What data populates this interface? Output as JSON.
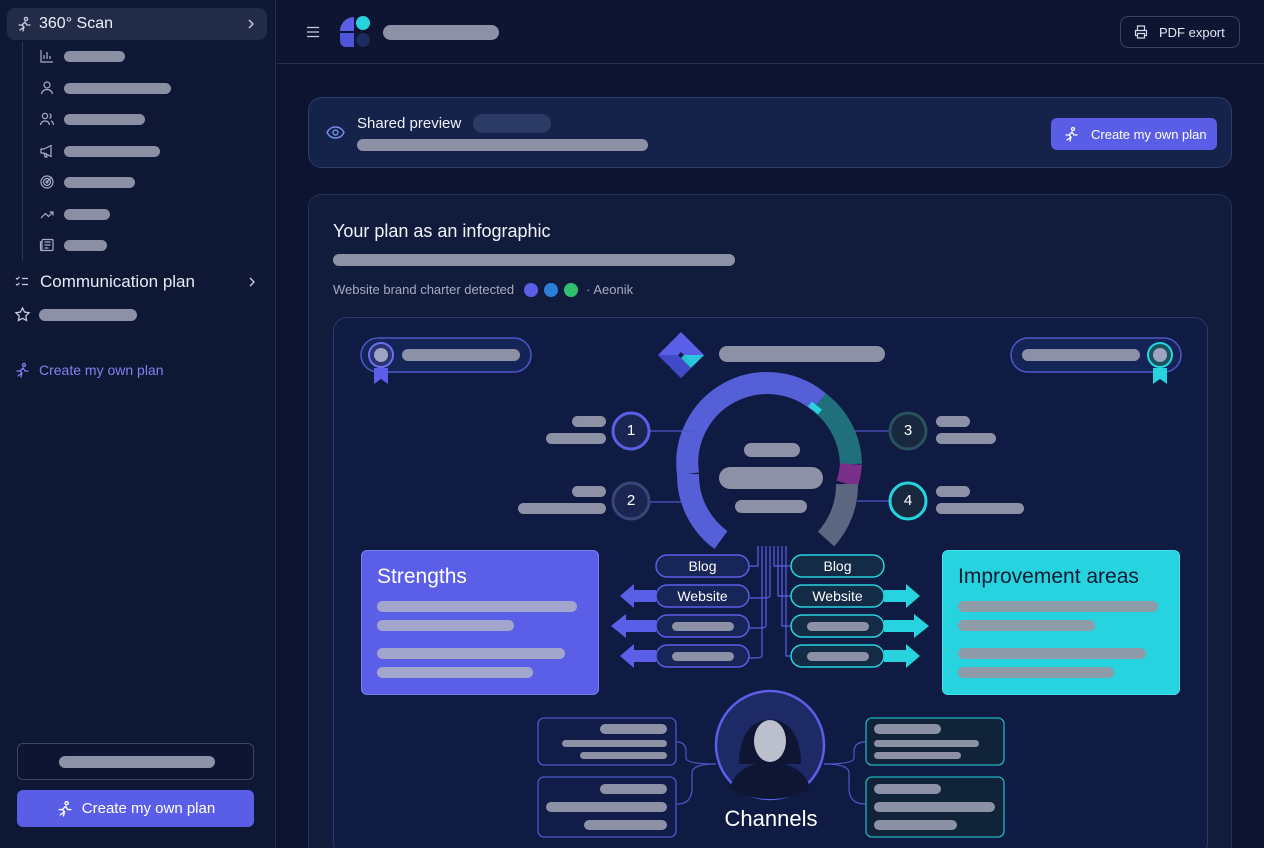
{
  "sidebar": {
    "scan": {
      "label": "360° Scan",
      "icon": "runner-icon"
    },
    "sub_items": [
      {
        "icon": "bar-chart-icon"
      },
      {
        "icon": "user-icon"
      },
      {
        "icon": "users-icon"
      },
      {
        "icon": "megaphone-icon"
      },
      {
        "icon": "target-icon"
      },
      {
        "icon": "trend-up-icon"
      },
      {
        "icon": "newspaper-icon"
      }
    ],
    "communication_plan": {
      "label": "Communication plan",
      "icon": "checklist-icon"
    },
    "favorites": {
      "icon": "star-icon"
    },
    "create_link": {
      "label": "Create my own plan",
      "icon": "sparkle-runner-icon"
    },
    "create_button": {
      "label": "Create my own plan"
    }
  },
  "header": {
    "menu_icon": "hamburger-icon",
    "pdf_export": {
      "label": "PDF export",
      "icon": "printer-icon"
    }
  },
  "preview": {
    "title": "Shared preview",
    "button_label": "Create my own plan",
    "icon": "eye-icon"
  },
  "card": {
    "title": "Your plan as an infographic",
    "charter_label": "Website brand charter detected",
    "charter_font": "· Aeonik",
    "brand_colors": [
      "#5b5fe8",
      "#2a7fd6",
      "#2fbf6e"
    ],
    "steps": [
      "1",
      "2",
      "3",
      "4"
    ],
    "left_pills": [
      "Blog",
      "Website"
    ],
    "right_pills": [
      "Blog",
      "Website"
    ],
    "strengths_title": "Strengths",
    "improvements_title": "Improvement areas",
    "channels_title": "Channels"
  },
  "colors": {
    "accent": "#5a5ee6",
    "teal": "#27d3de",
    "background": "#0c1431"
  }
}
